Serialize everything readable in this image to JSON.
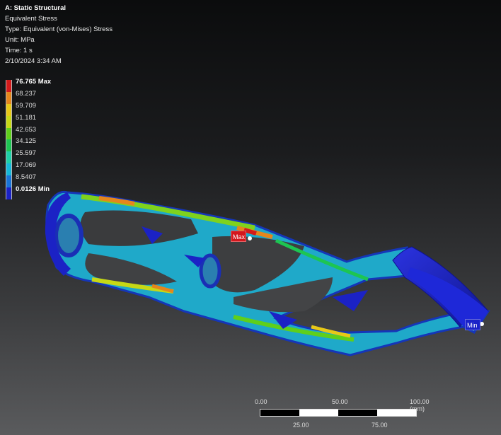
{
  "info": {
    "title": "A: Static Structural",
    "result": "Equivalent Stress",
    "type": "Type: Equivalent (von-Mises) Stress",
    "unit": "Unit: MPa",
    "time": "Time: 1 s",
    "date": "2/10/2024 3:34 AM"
  },
  "legend": [
    {
      "label": "76.765 Max",
      "color": "#d31a1a",
      "bold": true
    },
    {
      "label": "68.237",
      "color": "#e5861c",
      "bold": false
    },
    {
      "label": "59.709",
      "color": "#e8c817",
      "bold": false
    },
    {
      "label": "51.181",
      "color": "#c7d815",
      "bold": false
    },
    {
      "label": "42.653",
      "color": "#5fcf1b",
      "bold": false
    },
    {
      "label": "34.125",
      "color": "#1dc552",
      "bold": false
    },
    {
      "label": "25.597",
      "color": "#1ed0a7",
      "bold": false
    },
    {
      "label": "17.069",
      "color": "#15b8d8",
      "bold": false
    },
    {
      "label": "8.5407",
      "color": "#1874d8",
      "bold": false
    },
    {
      "label": "0.0126 Min",
      "color": "#1b22c5",
      "bold": true
    }
  ],
  "tags": {
    "max": "Max",
    "min": "Min"
  },
  "scale": {
    "top_labels": [
      "0.00",
      "50.00",
      "100.00 (mm)"
    ],
    "bottom_labels": [
      "25.00",
      "75.00"
    ]
  }
}
